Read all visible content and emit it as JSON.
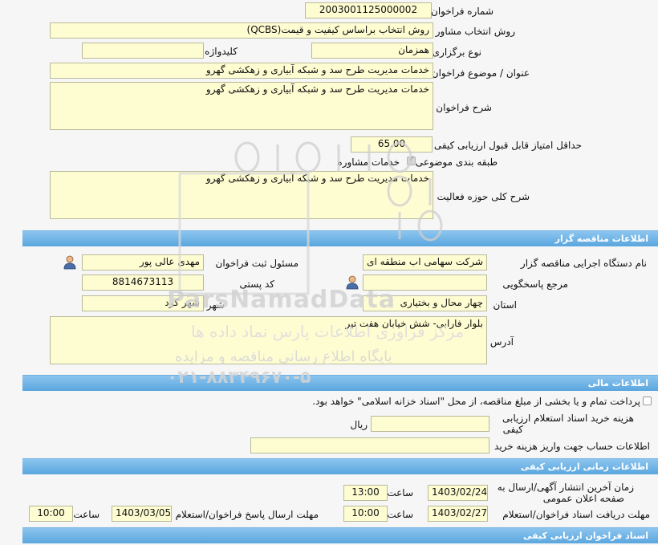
{
  "tender": {
    "number_label": "شماره فراخوان",
    "number_value": "2003001125000002",
    "consultant_method_label": "روش انتخاب مشاور",
    "consultant_method_value": "روش انتخاب براساس کیفیت و قیمت(QCBS)",
    "holding_type_label": "نوع برگزاری",
    "holding_type_value": "همزمان",
    "keyword_label": "کلیدواژه",
    "keyword_value": "",
    "subject_label": "عنوان / موضوع فراخوان",
    "subject_value": "خدمات مدیریت طرح سد و شبکه آبیاری و زهکشی گهرو",
    "description_label": "شرح فراخوان",
    "description_value": "خدمات مدیریت طرح سد و شبکه آبیاری و زهکشی گهرو",
    "min_quality_score_label": "حداقل امتیاز قابل قبول ارزیابی کیفی",
    "min_quality_score_value": "65.00",
    "subject_category_label": "طبقه بندی موضوعی",
    "subject_category_option": "خدمات مشاوره",
    "subject_category_checked": true,
    "activity_scope_label": "شرح کلی حوزه فعالیت",
    "activity_scope_value": "خدمات مدیریت طرح سد و شبکه آبیاری و زهکشی گهرو"
  },
  "organizer": {
    "section_title": "اطلاعات مناقصه گزار",
    "agency_label": "نام دستگاه اجرایی مناقصه گزار",
    "agency_value": "شرکت سهامی اب منطقه ای",
    "registrar_label": "مسئول ثبت فراخوان",
    "registrar_value": "مهدی عالی پور",
    "response_ref_label": "مرجع پاسخگویی",
    "response_ref_value": "",
    "postal_code_label": "کد پستی",
    "postal_code_value": "8814673113",
    "province_label": "استان",
    "province_value": "چهار محال و بختیاری",
    "city_label": "شهر",
    "city_value": "شهر کرد",
    "address_label": "آدرس",
    "address_value": "بلوار فارابی- شش خیابان هفت تیر"
  },
  "financial": {
    "section_title": "اطلاعات مالی",
    "treasury_text": "پرداخت تمام و یا بخشی از مبلغ مناقصه، از محل \"اسناد خزانه اسلامی\" خواهد بود.",
    "treasury_checked": false,
    "fee_label_line1": "هزینه خرید اسناد استعلام ارزیابی",
    "fee_label_line2": "کیفی",
    "fee_value": "",
    "fee_unit": "ریال",
    "account_label": "اطلاعات حساب جهت واریز هزینه خرید",
    "account_value": ""
  },
  "schedule": {
    "section_title": "اطلاعات زمانی ارزیابی کیفی",
    "publish_label_line1": "زمان آخرین انتشار آگهی/ارسال به",
    "publish_label_line2": "صفحه اعلان عمومی",
    "publish_date": "1403/02/24",
    "publish_time": "13:00",
    "time_label": "ساعت",
    "doc_deadline_label": "مهلت دریافت اسناد فراخوان/استعلام",
    "doc_deadline_date": "1403/02/27",
    "doc_deadline_time": "10:00",
    "response_deadline_label": "مهلت ارسال پاسخ فراخوان/استعلام",
    "response_deadline_date": "1403/03/05",
    "response_deadline_time": "10:00"
  },
  "documents": {
    "section_title": "اسناد فراخوان ارزیابی کیفی"
  },
  "watermark": {
    "brand_latin": "ParsNamadData",
    "line1": "مرکز فراوری اطلاعات پارس نماد داده ها",
    "line2": "پایگاه اطلاع رسانی مناقصه و مزایده",
    "phone": "۰۲۱-۸۸۳۴۹۶۷۰-۵"
  },
  "colors": {
    "field_bg": "#fefdd2",
    "section_bar": "#6fb0e2",
    "page_bg": "#f6f6f6"
  }
}
